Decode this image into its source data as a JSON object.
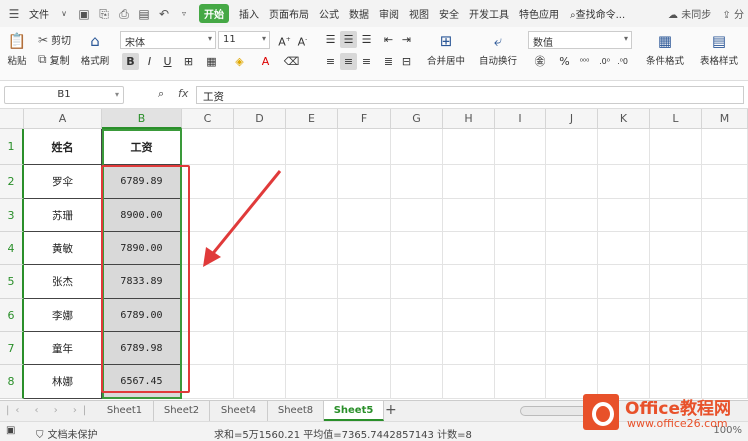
{
  "menubar": {
    "file": "文件",
    "start": "开始",
    "tabs": [
      "插入",
      "页面布局",
      "公式",
      "数据",
      "审阅",
      "视图",
      "安全",
      "开发工具",
      "特色应用"
    ],
    "search": "查找命令...",
    "sync": "未同步",
    "share": "分"
  },
  "ribbon": {
    "paste": "粘贴",
    "cut": "剪切",
    "copy": "复制",
    "format_painter": "格式刷",
    "font_name": "宋体",
    "font_size": "11",
    "merge": "合并居中",
    "wrap": "自动换行",
    "number_format": "数值",
    "cond_format": "条件格式",
    "table_style": "表格样式"
  },
  "formula_bar": {
    "name_box": "B1",
    "fx": "fx",
    "content": "工资"
  },
  "columns": [
    "A",
    "B",
    "C",
    "D",
    "E",
    "F",
    "G",
    "H",
    "I",
    "J",
    "K",
    "L",
    "M"
  ],
  "rows": [
    "1",
    "2",
    "3",
    "4",
    "5",
    "6",
    "7",
    "8"
  ],
  "table": {
    "headers": [
      "姓名",
      "工资"
    ],
    "data": [
      [
        "罗伞",
        "6789.89"
      ],
      [
        "苏珊",
        "8900.00"
      ],
      [
        "黄敏",
        "7890.00"
      ],
      [
        "张杰",
        "7833.89"
      ],
      [
        "李娜",
        "6789.00"
      ],
      [
        "童年",
        "6789.98"
      ],
      [
        "林娜",
        "6567.45"
      ]
    ]
  },
  "sheets": [
    "Sheet1",
    "Sheet2",
    "Sheet4",
    "Sheet8",
    "Sheet5"
  ],
  "active_sheet": "Sheet5",
  "status": {
    "protect": "文档未保护",
    "summary": "求和=5万1560.21  平均值=7365.7442857143  计数=8",
    "zoom": "100%"
  },
  "logo": {
    "name": "Office教程网",
    "url": "www.office26.com"
  },
  "colors": {
    "accent": "#2a8f2a",
    "annotation": "#e03a3a",
    "logo": "#e8512a"
  }
}
